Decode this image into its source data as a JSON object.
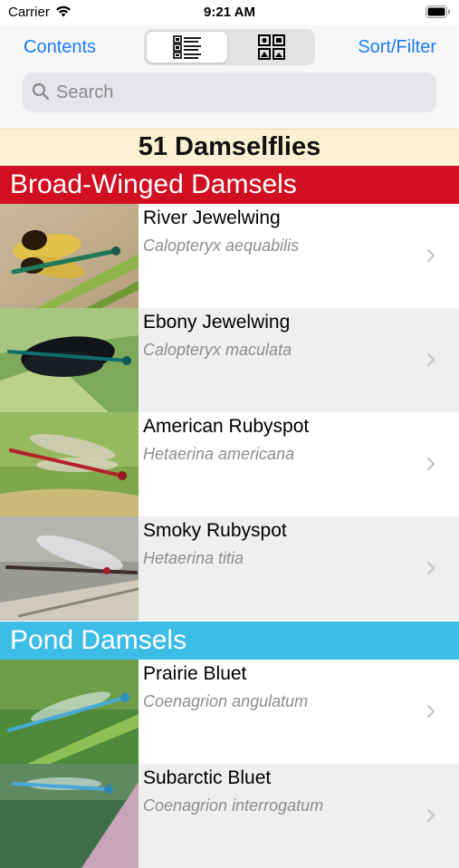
{
  "status_bar": {
    "carrier": "Carrier",
    "time": "9:21 AM"
  },
  "nav": {
    "contents_label": "Contents",
    "sort_filter_label": "Sort/Filter",
    "segments": [
      "list-view-icon",
      "grid-view-icon"
    ],
    "selected_segment": 0
  },
  "search": {
    "placeholder": "Search"
  },
  "count_title": "51 Damselflies",
  "sections": [
    {
      "title": "Broad-Winged Damsels",
      "color": "#d20e21",
      "items": [
        {
          "name": "River Jewelwing",
          "latin": "Calopteryx aequabilis"
        },
        {
          "name": "Ebony Jewelwing",
          "latin": "Calopteryx maculata"
        },
        {
          "name": "American Rubyspot",
          "latin": "Hetaerina americana"
        },
        {
          "name": "Smoky Rubyspot",
          "latin": "Hetaerina titia"
        }
      ]
    },
    {
      "title": "Pond Damsels",
      "color": "#3cbde6",
      "items": [
        {
          "name": "Prairie Bluet",
          "latin": "Coenagrion angulatum"
        },
        {
          "name": "Subarctic Bluet",
          "latin": "Coenagrion interrogatum"
        }
      ]
    }
  ],
  "colors": {
    "accent": "#1a7cf7",
    "row_alt": "#efefef",
    "count_bar": "#fbf1d2"
  }
}
